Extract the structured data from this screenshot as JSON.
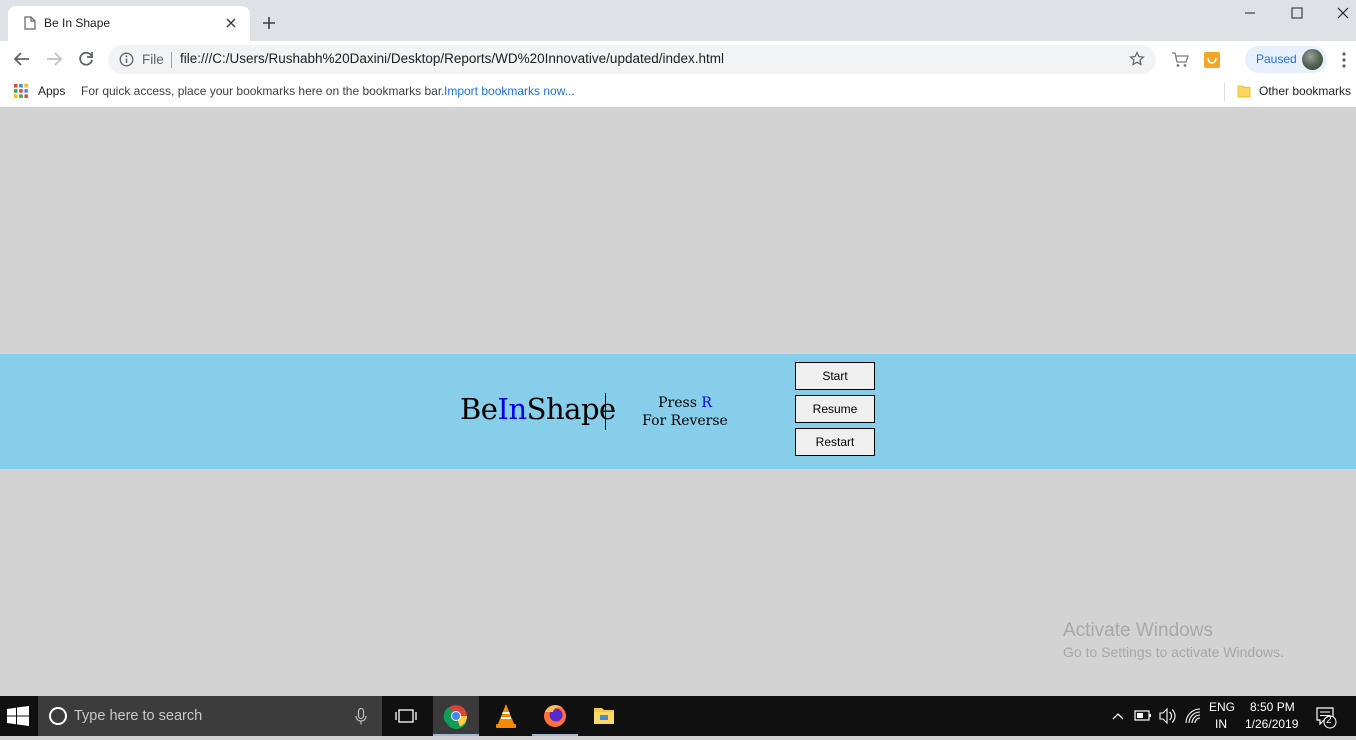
{
  "browser": {
    "tab": {
      "title": "Be In Shape"
    },
    "address": {
      "scheme_label": "File",
      "url": "file:///C:/Users/Rushabh%20Daxini/Desktop/Reports/WD%20Innovative/updated/index.html"
    },
    "profile": {
      "status_label": "Paused"
    }
  },
  "bookmarks": {
    "apps_label": "Apps",
    "hint": "For quick access, place your bookmarks here on the bookmarks bar.",
    "import_link": "Import bookmarks now...",
    "other_label": "Other bookmarks"
  },
  "page": {
    "logo": {
      "part1": "Be",
      "part2": "In",
      "part3": "Shape"
    },
    "hint": {
      "line1_prefix": "Press ",
      "key": "R",
      "line2": "For Reverse"
    },
    "buttons": {
      "start": "Start",
      "resume": "Resume",
      "restart": "Restart"
    },
    "colors": {
      "banner": "#87ceeb",
      "background": "#d3d3d3",
      "accent": "#0000ee"
    }
  },
  "watermark": {
    "line1": "Activate Windows",
    "line2": "Go to Settings to activate Windows."
  },
  "taskbar": {
    "search_placeholder": "Type here to search",
    "lang_top": "ENG",
    "lang_bottom": "IN",
    "time": "8:50 PM",
    "date": "1/26/2019",
    "notification_count": "2",
    "pinned_icons": [
      "task-view-icon",
      "chrome-icon",
      "vlc-icon",
      "firefox-icon",
      "file-explorer-icon"
    ]
  }
}
